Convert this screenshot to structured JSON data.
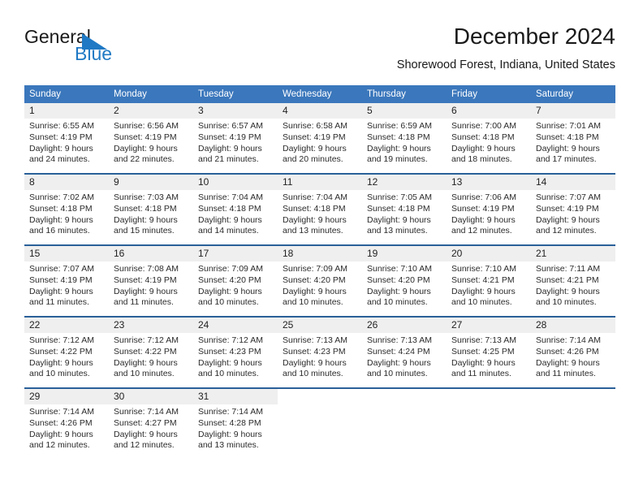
{
  "brand": {
    "name_part1": "General",
    "name_part2": "Blue",
    "accent_color": "#1f79c4",
    "logo_icon": "triangle-flag-icon"
  },
  "header": {
    "title": "December 2024",
    "subtitle": "Shorewood Forest, Indiana, United States"
  },
  "calendar": {
    "header_bg": "#3b77bc",
    "header_text_color": "#ffffff",
    "separator_color": "#2a6099",
    "daynum_band_color": "#efefef",
    "weekdays": [
      "Sunday",
      "Monday",
      "Tuesday",
      "Wednesday",
      "Thursday",
      "Friday",
      "Saturday"
    ],
    "weeks": [
      [
        {
          "day": "1",
          "sunrise": "Sunrise: 6:55 AM",
          "sunset": "Sunset: 4:19 PM",
          "daylight_line1": "Daylight: 9 hours",
          "daylight_line2": "and 24 minutes."
        },
        {
          "day": "2",
          "sunrise": "Sunrise: 6:56 AM",
          "sunset": "Sunset: 4:19 PM",
          "daylight_line1": "Daylight: 9 hours",
          "daylight_line2": "and 22 minutes."
        },
        {
          "day": "3",
          "sunrise": "Sunrise: 6:57 AM",
          "sunset": "Sunset: 4:19 PM",
          "daylight_line1": "Daylight: 9 hours",
          "daylight_line2": "and 21 minutes."
        },
        {
          "day": "4",
          "sunrise": "Sunrise: 6:58 AM",
          "sunset": "Sunset: 4:19 PM",
          "daylight_line1": "Daylight: 9 hours",
          "daylight_line2": "and 20 minutes."
        },
        {
          "day": "5",
          "sunrise": "Sunrise: 6:59 AM",
          "sunset": "Sunset: 4:18 PM",
          "daylight_line1": "Daylight: 9 hours",
          "daylight_line2": "and 19 minutes."
        },
        {
          "day": "6",
          "sunrise": "Sunrise: 7:00 AM",
          "sunset": "Sunset: 4:18 PM",
          "daylight_line1": "Daylight: 9 hours",
          "daylight_line2": "and 18 minutes."
        },
        {
          "day": "7",
          "sunrise": "Sunrise: 7:01 AM",
          "sunset": "Sunset: 4:18 PM",
          "daylight_line1": "Daylight: 9 hours",
          "daylight_line2": "and 17 minutes."
        }
      ],
      [
        {
          "day": "8",
          "sunrise": "Sunrise: 7:02 AM",
          "sunset": "Sunset: 4:18 PM",
          "daylight_line1": "Daylight: 9 hours",
          "daylight_line2": "and 16 minutes."
        },
        {
          "day": "9",
          "sunrise": "Sunrise: 7:03 AM",
          "sunset": "Sunset: 4:18 PM",
          "daylight_line1": "Daylight: 9 hours",
          "daylight_line2": "and 15 minutes."
        },
        {
          "day": "10",
          "sunrise": "Sunrise: 7:04 AM",
          "sunset": "Sunset: 4:18 PM",
          "daylight_line1": "Daylight: 9 hours",
          "daylight_line2": "and 14 minutes."
        },
        {
          "day": "11",
          "sunrise": "Sunrise: 7:04 AM",
          "sunset": "Sunset: 4:18 PM",
          "daylight_line1": "Daylight: 9 hours",
          "daylight_line2": "and 13 minutes."
        },
        {
          "day": "12",
          "sunrise": "Sunrise: 7:05 AM",
          "sunset": "Sunset: 4:18 PM",
          "daylight_line1": "Daylight: 9 hours",
          "daylight_line2": "and 13 minutes."
        },
        {
          "day": "13",
          "sunrise": "Sunrise: 7:06 AM",
          "sunset": "Sunset: 4:19 PM",
          "daylight_line1": "Daylight: 9 hours",
          "daylight_line2": "and 12 minutes."
        },
        {
          "day": "14",
          "sunrise": "Sunrise: 7:07 AM",
          "sunset": "Sunset: 4:19 PM",
          "daylight_line1": "Daylight: 9 hours",
          "daylight_line2": "and 12 minutes."
        }
      ],
      [
        {
          "day": "15",
          "sunrise": "Sunrise: 7:07 AM",
          "sunset": "Sunset: 4:19 PM",
          "daylight_line1": "Daylight: 9 hours",
          "daylight_line2": "and 11 minutes."
        },
        {
          "day": "16",
          "sunrise": "Sunrise: 7:08 AM",
          "sunset": "Sunset: 4:19 PM",
          "daylight_line1": "Daylight: 9 hours",
          "daylight_line2": "and 11 minutes."
        },
        {
          "day": "17",
          "sunrise": "Sunrise: 7:09 AM",
          "sunset": "Sunset: 4:20 PM",
          "daylight_line1": "Daylight: 9 hours",
          "daylight_line2": "and 10 minutes."
        },
        {
          "day": "18",
          "sunrise": "Sunrise: 7:09 AM",
          "sunset": "Sunset: 4:20 PM",
          "daylight_line1": "Daylight: 9 hours",
          "daylight_line2": "and 10 minutes."
        },
        {
          "day": "19",
          "sunrise": "Sunrise: 7:10 AM",
          "sunset": "Sunset: 4:20 PM",
          "daylight_line1": "Daylight: 9 hours",
          "daylight_line2": "and 10 minutes."
        },
        {
          "day": "20",
          "sunrise": "Sunrise: 7:10 AM",
          "sunset": "Sunset: 4:21 PM",
          "daylight_line1": "Daylight: 9 hours",
          "daylight_line2": "and 10 minutes."
        },
        {
          "day": "21",
          "sunrise": "Sunrise: 7:11 AM",
          "sunset": "Sunset: 4:21 PM",
          "daylight_line1": "Daylight: 9 hours",
          "daylight_line2": "and 10 minutes."
        }
      ],
      [
        {
          "day": "22",
          "sunrise": "Sunrise: 7:12 AM",
          "sunset": "Sunset: 4:22 PM",
          "daylight_line1": "Daylight: 9 hours",
          "daylight_line2": "and 10 minutes."
        },
        {
          "day": "23",
          "sunrise": "Sunrise: 7:12 AM",
          "sunset": "Sunset: 4:22 PM",
          "daylight_line1": "Daylight: 9 hours",
          "daylight_line2": "and 10 minutes."
        },
        {
          "day": "24",
          "sunrise": "Sunrise: 7:12 AM",
          "sunset": "Sunset: 4:23 PM",
          "daylight_line1": "Daylight: 9 hours",
          "daylight_line2": "and 10 minutes."
        },
        {
          "day": "25",
          "sunrise": "Sunrise: 7:13 AM",
          "sunset": "Sunset: 4:23 PM",
          "daylight_line1": "Daylight: 9 hours",
          "daylight_line2": "and 10 minutes."
        },
        {
          "day": "26",
          "sunrise": "Sunrise: 7:13 AM",
          "sunset": "Sunset: 4:24 PM",
          "daylight_line1": "Daylight: 9 hours",
          "daylight_line2": "and 10 minutes."
        },
        {
          "day": "27",
          "sunrise": "Sunrise: 7:13 AM",
          "sunset": "Sunset: 4:25 PM",
          "daylight_line1": "Daylight: 9 hours",
          "daylight_line2": "and 11 minutes."
        },
        {
          "day": "28",
          "sunrise": "Sunrise: 7:14 AM",
          "sunset": "Sunset: 4:26 PM",
          "daylight_line1": "Daylight: 9 hours",
          "daylight_line2": "and 11 minutes."
        }
      ],
      [
        {
          "day": "29",
          "sunrise": "Sunrise: 7:14 AM",
          "sunset": "Sunset: 4:26 PM",
          "daylight_line1": "Daylight: 9 hours",
          "daylight_line2": "and 12 minutes."
        },
        {
          "day": "30",
          "sunrise": "Sunrise: 7:14 AM",
          "sunset": "Sunset: 4:27 PM",
          "daylight_line1": "Daylight: 9 hours",
          "daylight_line2": "and 12 minutes."
        },
        {
          "day": "31",
          "sunrise": "Sunrise: 7:14 AM",
          "sunset": "Sunset: 4:28 PM",
          "daylight_line1": "Daylight: 9 hours",
          "daylight_line2": "and 13 minutes."
        },
        {
          "day": "",
          "sunrise": "",
          "sunset": "",
          "daylight_line1": "",
          "daylight_line2": ""
        },
        {
          "day": "",
          "sunrise": "",
          "sunset": "",
          "daylight_line1": "",
          "daylight_line2": ""
        },
        {
          "day": "",
          "sunrise": "",
          "sunset": "",
          "daylight_line1": "",
          "daylight_line2": ""
        },
        {
          "day": "",
          "sunrise": "",
          "sunset": "",
          "daylight_line1": "",
          "daylight_line2": ""
        }
      ]
    ]
  }
}
